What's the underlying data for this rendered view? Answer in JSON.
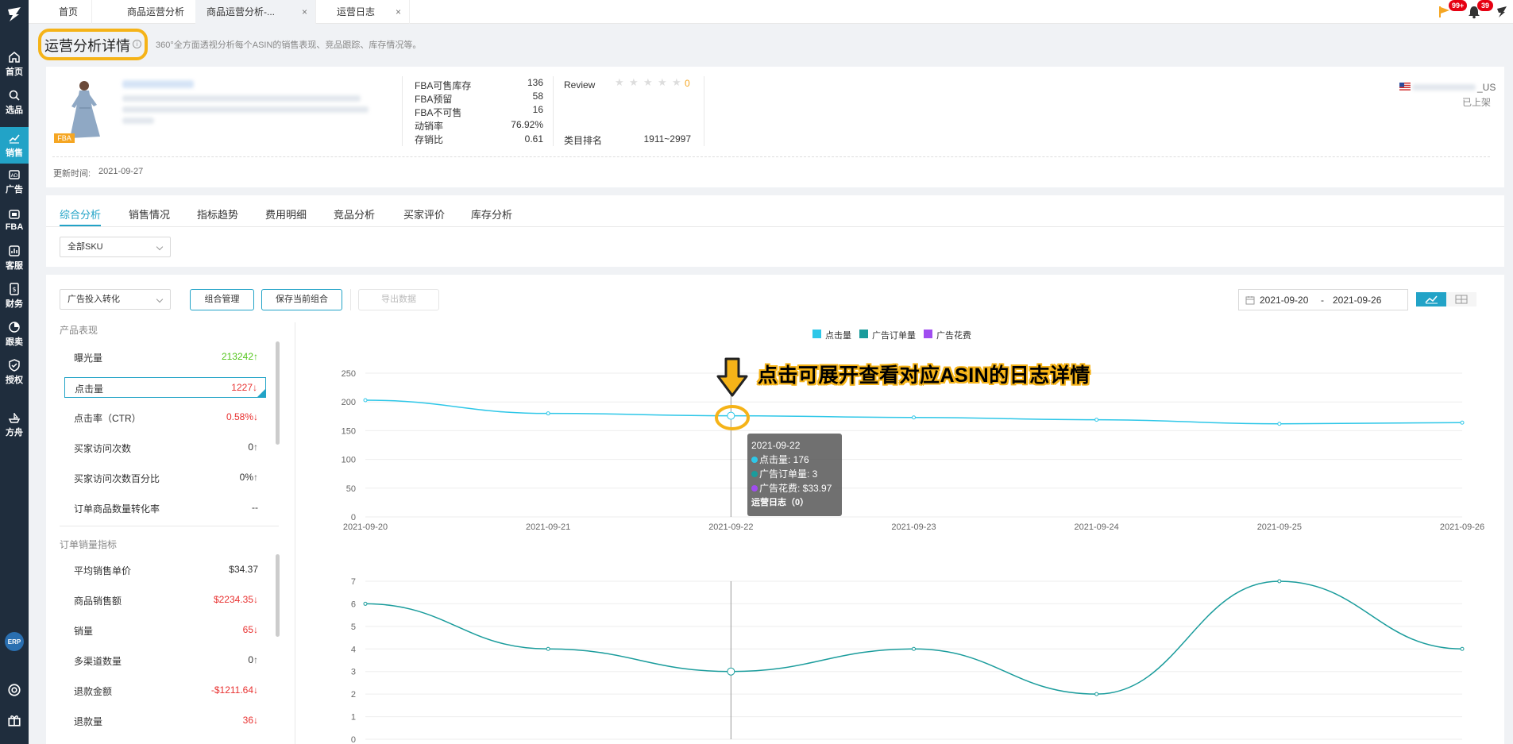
{
  "sidebar": {
    "items": [
      {
        "label": "首页",
        "icon": "home-icon"
      },
      {
        "label": "选品",
        "icon": "search-icon"
      },
      {
        "label": "销售",
        "icon": "chart-icon"
      },
      {
        "label": "广告",
        "icon": "ad-icon"
      },
      {
        "label": "FBA",
        "icon": "box-icon"
      },
      {
        "label": "客服",
        "icon": "service-icon"
      },
      {
        "label": "财务",
        "icon": "finance-icon"
      },
      {
        "label": "跟卖",
        "icon": "pie-icon"
      },
      {
        "label": "授权",
        "icon": "shield-icon"
      },
      {
        "label": "方舟",
        "icon": "ark-icon"
      }
    ],
    "erp_label": "ERP"
  },
  "tabs": [
    {
      "label": "首页"
    },
    {
      "label": "商品运营分析",
      "close": "×"
    },
    {
      "label": "商品运营分析-...",
      "close": "×"
    },
    {
      "label": "运营日志",
      "close": "×"
    }
  ],
  "notifications": {
    "flag_count": "99+",
    "bell_count": "39"
  },
  "page": {
    "title": "运营分析详情",
    "subtitle": "360°全方面透视分析每个ASIN的销售表现、竞品跟踪、库存情况等。"
  },
  "product": {
    "fba_tag": "FBA",
    "fba_stats": [
      {
        "label": "FBA可售库存",
        "value": "136"
      },
      {
        "label": "FBA预留",
        "value": "58"
      },
      {
        "label": "FBA不可售",
        "value": "16"
      },
      {
        "label": "动销率",
        "value": "76.92%"
      },
      {
        "label": "存销比",
        "value": "0.61"
      }
    ],
    "review_label": "Review",
    "review_count": "0",
    "rating_stars": 0,
    "category_rank_label": "类目排名",
    "category_rank_value": "1911~2997",
    "marketplace_suffix": "_US",
    "listing_status": "已上架",
    "update_label": "更新时间:",
    "update_time": "2021-09-27"
  },
  "sub_tabs": [
    "综合分析",
    "销售情况",
    "指标趋势",
    "费用明细",
    "竞品分析",
    "买家评价",
    "库存分析"
  ],
  "sku_filter": "全部SKU",
  "toolbar": {
    "combo_select": "广告投入转化",
    "manage_btn": "组合管理",
    "save_btn": "保存当前组合",
    "export_btn": "导出数据",
    "date_start": "2021-09-20",
    "date_sep": "-",
    "date_end": "2021-09-26"
  },
  "metrics_panel": {
    "product_section": "产品表现",
    "product_metrics": [
      {
        "label": "曝光量",
        "value": "213242",
        "trend": "up"
      },
      {
        "label": "点击量",
        "value": "1227",
        "trend": "down",
        "selected": true
      },
      {
        "label": "点击率（CTR）",
        "value": "0.58%",
        "trend": "down"
      },
      {
        "label": "买家访问次数",
        "value": "0",
        "trend": "neutral"
      },
      {
        "label": "买家访问次数百分比",
        "value": "0%",
        "trend": "neutral"
      },
      {
        "label": "订单商品数量转化率",
        "value": "--",
        "trend": "none"
      }
    ],
    "order_section": "订单销量指标",
    "order_metrics": [
      {
        "label": "平均销售单价",
        "value": "$34.37",
        "trend": "none"
      },
      {
        "label": "商品销售额",
        "value": "$2234.35",
        "trend": "down"
      },
      {
        "label": "销量",
        "value": "65",
        "trend": "down"
      },
      {
        "label": "多渠道数量",
        "value": "0",
        "trend": "neutral"
      },
      {
        "label": "退款金额",
        "value": "-$1211.64",
        "trend": "down"
      },
      {
        "label": "退款量",
        "value": "36",
        "trend": "down"
      }
    ]
  },
  "annotation": "点击可展开查看对应ASIN的日志详情",
  "colors": {
    "accent": "#22a3c7",
    "clicks": "#2ec7e8",
    "orders": "#1a9c9c",
    "spend": "#a04df0",
    "highlight": "#f5b318"
  },
  "tooltip": {
    "date": "2021-09-22",
    "clicks": "点击量: 176",
    "orders": "广告订单量: 3",
    "spend": "广告花费: $33.97",
    "log": "运营日志（0）"
  },
  "chart_data": [
    {
      "type": "line",
      "x": [
        "2021-09-20",
        "2021-09-21",
        "2021-09-22",
        "2021-09-23",
        "2021-09-24",
        "2021-09-25",
        "2021-09-26"
      ],
      "ylim": [
        0,
        250
      ],
      "yticks": [
        "250",
        "200",
        "150",
        "100",
        "50",
        "0"
      ],
      "legend": [
        "点击量",
        "广告订单量",
        "广告花费"
      ],
      "series": [
        {
          "name": "点击量",
          "values": [
            203,
            180,
            176,
            173,
            169,
            162,
            164
          ]
        }
      ]
    },
    {
      "type": "line",
      "x": [
        "2021-09-20",
        "2021-09-21",
        "2021-09-22",
        "2021-09-23",
        "2021-09-24",
        "2021-09-25",
        "2021-09-26"
      ],
      "ylim": [
        0,
        7
      ],
      "yticks": [
        "7",
        "6",
        "5",
        "4",
        "3",
        "2",
        "1",
        "0"
      ],
      "series": [
        {
          "name": "广告订单量",
          "values": [
            6,
            4,
            3,
            4,
            2,
            7,
            4
          ]
        }
      ]
    }
  ]
}
